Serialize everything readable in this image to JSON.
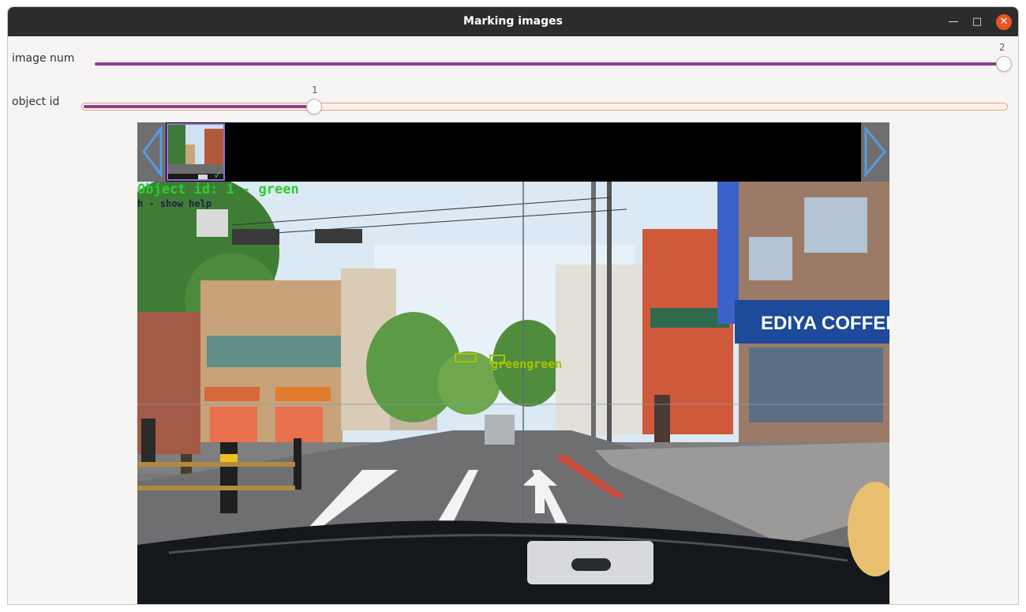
{
  "window": {
    "title": "Marking images"
  },
  "controls": {
    "image_num": {
      "label": "image num",
      "value": "2",
      "fraction": 1.0
    },
    "object_id": {
      "label": "object id",
      "value": "1",
      "fraction": 0.2
    }
  },
  "viewer": {
    "overlay_id_text": "Object id: 1   - green",
    "overlay_help_text": "h - show help",
    "bbox_labels": [
      "green",
      "green"
    ],
    "thumbnail_checked": true,
    "signs": {
      "ediya": "EDIYA COFFEE"
    }
  },
  "icons": {
    "minimize": "minimize-icon",
    "maximize": "maximize-icon",
    "close": "close-icon",
    "prev": "arrow-left-icon",
    "next": "arrow-right-icon",
    "check": "checkmark-icon"
  },
  "colors": {
    "accent": "#8a3f8f",
    "close": "#e95420",
    "overlay_green": "#2ecc2e",
    "bbox": "#a8c400"
  }
}
